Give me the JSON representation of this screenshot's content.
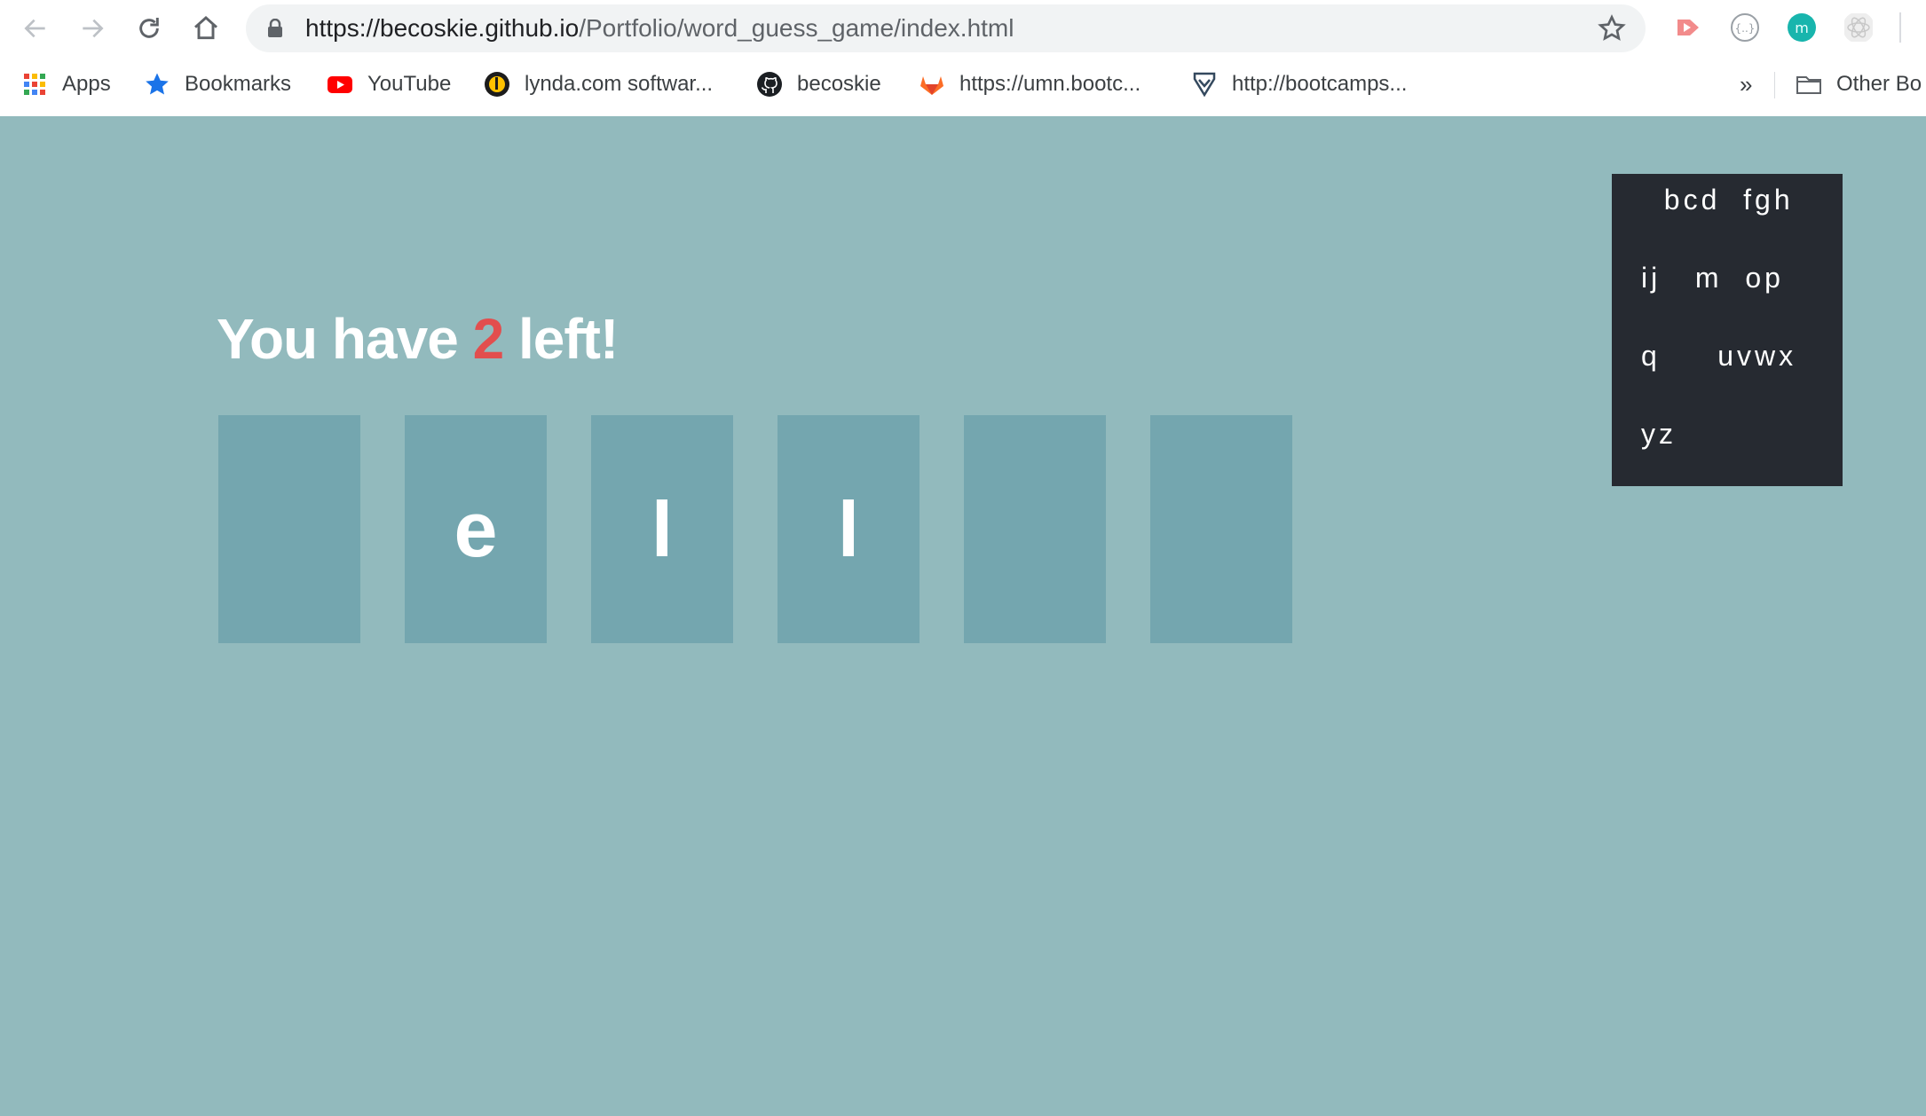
{
  "browser": {
    "url_domain": "https://becoskie.github.io",
    "url_path": "/Portfolio/word_guess_game/index.html",
    "bookmarks": [
      {
        "label": "Apps",
        "icon": "apps-grid-icon"
      },
      {
        "label": "Bookmarks",
        "icon": "star-icon"
      },
      {
        "label": "YouTube",
        "icon": "youtube-icon"
      },
      {
        "label": "lynda.com softwar...",
        "icon": "lynda-icon"
      },
      {
        "label": "becoskie",
        "icon": "github-icon"
      },
      {
        "label": "https://umn.bootc...",
        "icon": "gitlab-icon"
      },
      {
        "label": "http://bootcamps...",
        "icon": "shield-check-icon"
      },
      {
        "label": "Other Bo",
        "icon": "folder-icon"
      }
    ],
    "overflow": "»"
  },
  "game": {
    "status_prefix": "You have ",
    "guesses_left": "2",
    "status_suffix": " left!",
    "tiles": [
      "",
      "e",
      "l",
      "l",
      "",
      ""
    ]
  },
  "letters_panel": {
    "rows": [
      "  bcd  fgh",
      "ij   m  op",
      "q     uvwx",
      "yz"
    ]
  },
  "colors": {
    "page_background": "#92babd",
    "tile": "#74a6af",
    "panel": "#262a31",
    "count_accent": "#e24e4e"
  }
}
